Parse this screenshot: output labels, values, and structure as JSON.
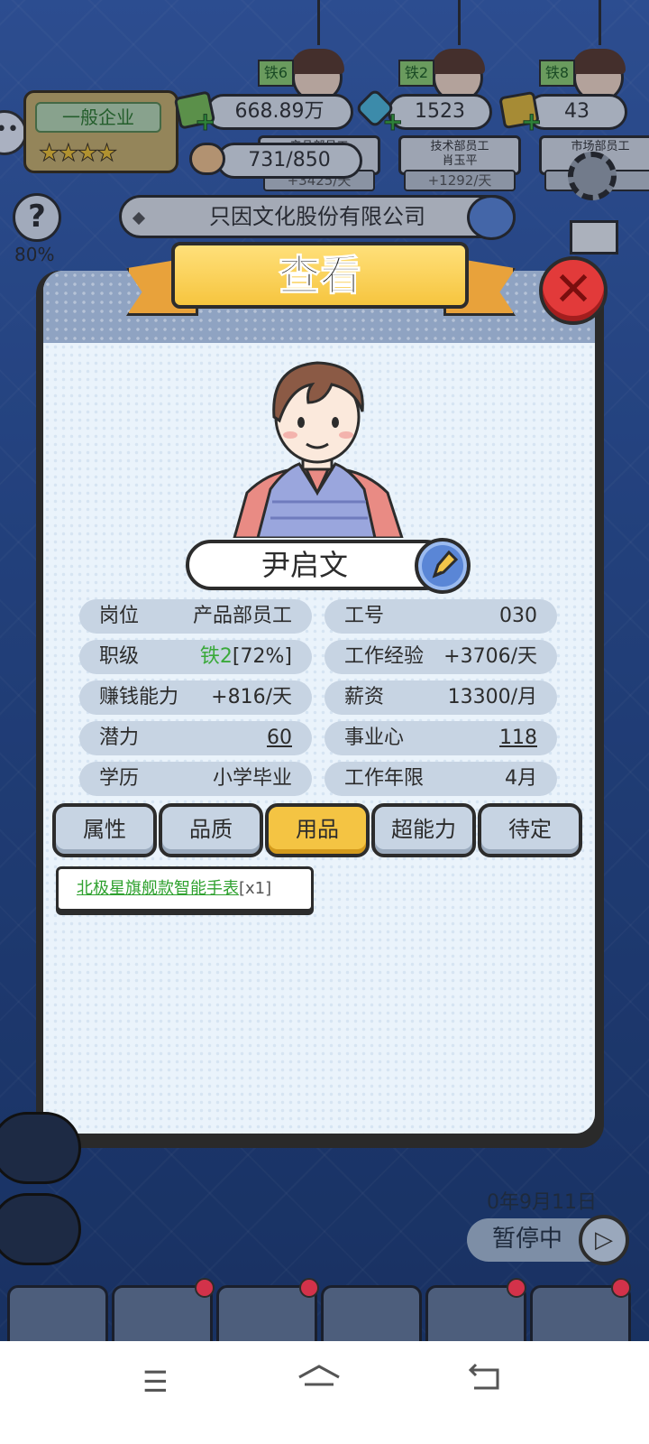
{
  "hud": {
    "company_rank": "一般企业",
    "company_stars": "★★★★",
    "money": "668.89万",
    "gems": "1523",
    "gold": "43",
    "reputation": "731/850",
    "company_name": "只因文化股份有限公司",
    "help_percent": "80%"
  },
  "staff_strip": [
    {
      "tag": "铁6",
      "role": "产品部员工",
      "name": "",
      "rate": "+3425/天"
    },
    {
      "tag": "铁2",
      "role": "技术部员工",
      "name": "肖玉平",
      "rate": "+1292/天"
    },
    {
      "tag": "铁8",
      "role": "市场部员工",
      "name": "",
      "rate": "天"
    }
  ],
  "modal": {
    "title": "查看",
    "employee_name": "尹启文",
    "info_left": [
      {
        "label": "岗位",
        "value": "产品部员工"
      },
      {
        "label": "职级",
        "value_prefix": "铁2",
        "value": "[72%]"
      },
      {
        "label": "赚钱能力",
        "value": "+816/天"
      },
      {
        "label": "潜力",
        "value": "60"
      },
      {
        "label": "学历",
        "value": "小学毕业"
      }
    ],
    "info_right": [
      {
        "label": "工号",
        "value": "030"
      },
      {
        "label": "工作经验",
        "value": "+3706/天"
      },
      {
        "label": "薪资",
        "value": "13300/月"
      },
      {
        "label": "事业心",
        "value": "118"
      },
      {
        "label": "工作年限",
        "value": "4月"
      }
    ],
    "tabs": [
      {
        "label": "属性",
        "active": false
      },
      {
        "label": "品质",
        "active": false
      },
      {
        "label": "用品",
        "active": true
      },
      {
        "label": "超能力",
        "active": false
      },
      {
        "label": "待定",
        "active": false
      }
    ],
    "items": [
      {
        "name": "北极星旗舰款智能手表",
        "qty": "[x1]"
      }
    ]
  },
  "footer": {
    "date": "0年9月11日",
    "pause_label": "暂停中"
  },
  "colors": {
    "accent_yellow": "#f4c443",
    "close_red": "#e23a3a",
    "rank_green": "#3aa93a"
  }
}
